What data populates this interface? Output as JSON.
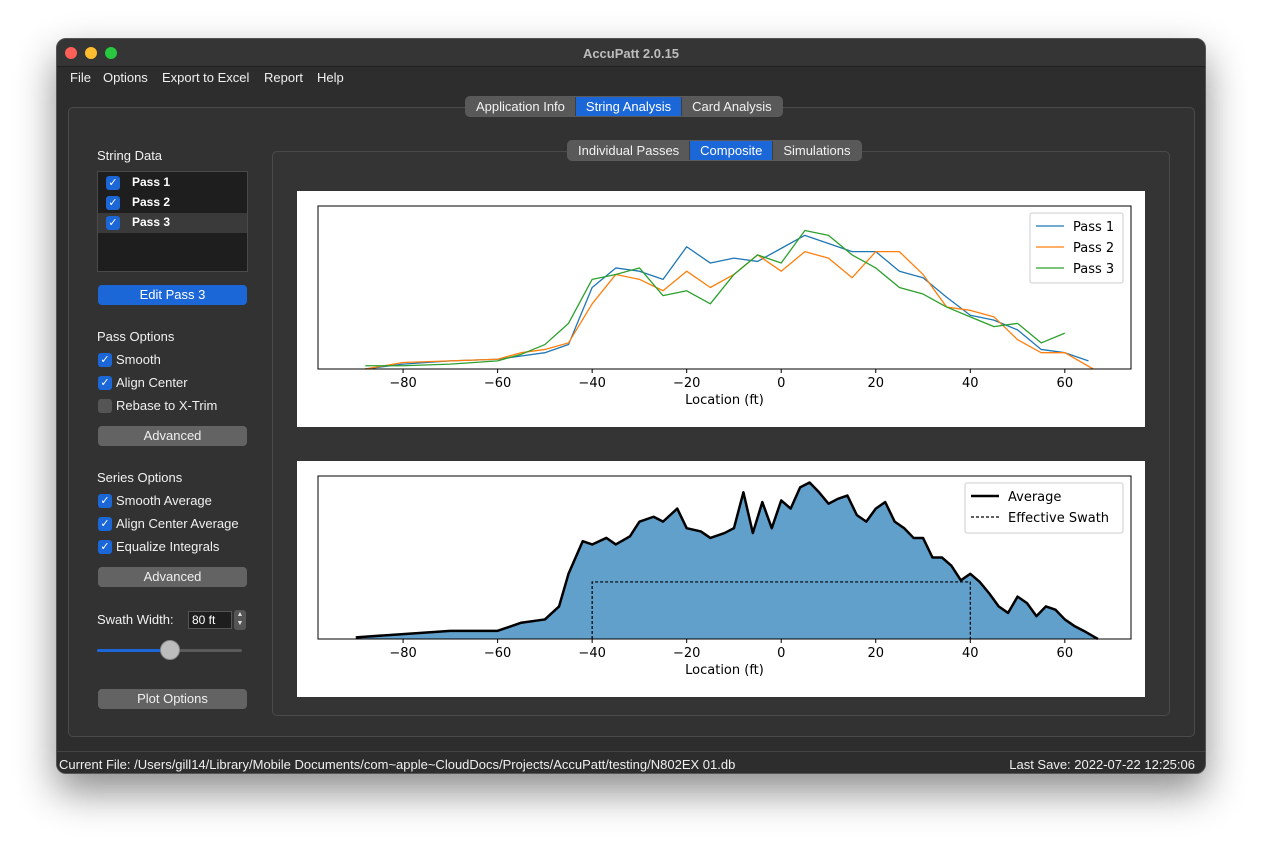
{
  "window": {
    "title": "AccuPatt 2.0.15"
  },
  "menu": [
    "File",
    "Options",
    "Export to Excel",
    "Report",
    "Help"
  ],
  "main_tabs": [
    {
      "label": "Application Info",
      "active": false
    },
    {
      "label": "String Analysis",
      "active": true
    },
    {
      "label": "Card Analysis",
      "active": false
    }
  ],
  "sub_tabs": [
    {
      "label": "Individual Passes",
      "active": false
    },
    {
      "label": "Composite",
      "active": true
    },
    {
      "label": "Simulations",
      "active": false
    }
  ],
  "sidebar": {
    "string_data_label": "String Data",
    "passes": [
      {
        "label": "Pass 1",
        "checked": true
      },
      {
        "label": "Pass 2",
        "checked": true
      },
      {
        "label": "Pass 3",
        "checked": true
      }
    ],
    "edit_button": "Edit Pass 3",
    "pass_options_label": "Pass Options",
    "pass_options": [
      {
        "label": "Smooth",
        "checked": true
      },
      {
        "label": "Align Center",
        "checked": true
      },
      {
        "label": "Rebase to X-Trim",
        "checked": false
      }
    ],
    "advanced_label": "Advanced",
    "series_options_label": "Series Options",
    "series_options": [
      {
        "label": "Smooth Average",
        "checked": true
      },
      {
        "label": "Align Center Average",
        "checked": true
      },
      {
        "label": "Equalize Integrals",
        "checked": true
      }
    ],
    "swath_label": "Swath Width:",
    "swath_value": "80 ft",
    "swath_slider_fraction": 0.5,
    "plot_options_label": "Plot Options"
  },
  "colors": {
    "accent": "#1b67d8",
    "pass1": "#1f77b4",
    "pass2": "#ff7f0e",
    "pass3": "#2ca02c",
    "average_fill": "#62a0cc"
  },
  "chart_data": [
    {
      "type": "line",
      "xlabel": "Location (ft)",
      "xlim": [
        -98,
        74
      ],
      "ylim": [
        0,
        1
      ],
      "xticks": [
        -80,
        -60,
        -40,
        -20,
        0,
        20,
        40,
        60
      ],
      "legend": "top-right",
      "grid": false,
      "series": [
        {
          "name": "Pass 1",
          "x": [
            -88,
            -80,
            -70,
            -60,
            -55,
            -50,
            -45,
            -40,
            -35,
            -30,
            -25,
            -20,
            -15,
            -10,
            -5,
            0,
            5,
            10,
            15,
            20,
            25,
            30,
            35,
            40,
            45,
            50,
            55,
            60,
            65
          ],
          "y": [
            0.0,
            0.03,
            0.05,
            0.06,
            0.08,
            0.1,
            0.15,
            0.5,
            0.62,
            0.6,
            0.55,
            0.75,
            0.65,
            0.68,
            0.66,
            0.74,
            0.82,
            0.77,
            0.72,
            0.72,
            0.6,
            0.56,
            0.44,
            0.33,
            0.3,
            0.24,
            0.12,
            0.1,
            0.05
          ]
        },
        {
          "name": "Pass 2",
          "x": [
            -88,
            -80,
            -70,
            -60,
            -55,
            -50,
            -45,
            -40,
            -35,
            -30,
            -25,
            -20,
            -15,
            -10,
            -5,
            0,
            5,
            10,
            15,
            20,
            25,
            30,
            35,
            40,
            45,
            50,
            55,
            60,
            66
          ],
          "y": [
            0.0,
            0.04,
            0.05,
            0.06,
            0.1,
            0.12,
            0.16,
            0.4,
            0.58,
            0.55,
            0.48,
            0.6,
            0.5,
            0.58,
            0.7,
            0.6,
            0.72,
            0.68,
            0.56,
            0.72,
            0.72,
            0.58,
            0.38,
            0.36,
            0.32,
            0.18,
            0.1,
            0.1,
            0.0
          ]
        },
        {
          "name": "Pass 3",
          "x": [
            -88,
            -80,
            -70,
            -60,
            -55,
            -50,
            -45,
            -40,
            -35,
            -30,
            -25,
            -20,
            -15,
            -10,
            -5,
            0,
            5,
            10,
            15,
            20,
            25,
            30,
            35,
            40,
            45,
            50,
            55,
            60
          ],
          "y": [
            0.02,
            0.02,
            0.03,
            0.05,
            0.09,
            0.15,
            0.28,
            0.55,
            0.58,
            0.62,
            0.45,
            0.48,
            0.4,
            0.58,
            0.7,
            0.65,
            0.85,
            0.82,
            0.7,
            0.62,
            0.5,
            0.46,
            0.38,
            0.32,
            0.26,
            0.28,
            0.16,
            0.22
          ]
        }
      ]
    },
    {
      "type": "area",
      "xlabel": "Location (ft)",
      "xlim": [
        -98,
        74
      ],
      "ylim": [
        0,
        1
      ],
      "xticks": [
        -80,
        -60,
        -40,
        -20,
        0,
        20,
        40,
        60
      ],
      "legend": "top-right",
      "grid": false,
      "series": [
        {
          "name": "Average",
          "x": [
            -90,
            -80,
            -70,
            -60,
            -55,
            -50,
            -47,
            -45,
            -42,
            -40,
            -37,
            -35,
            -32,
            -30,
            -27,
            -25,
            -22,
            -20,
            -17,
            -15,
            -12,
            -10,
            -8,
            -6,
            -4,
            -2,
            0,
            2,
            4,
            6,
            8,
            10,
            12,
            14,
            16,
            18,
            20,
            22,
            24,
            26,
            28,
            30,
            32,
            34,
            36,
            38,
            40,
            42,
            44,
            46,
            48,
            50,
            52,
            54,
            56,
            58,
            60,
            62,
            64,
            67
          ],
          "y": [
            0.01,
            0.03,
            0.05,
            0.05,
            0.1,
            0.12,
            0.2,
            0.4,
            0.6,
            0.58,
            0.62,
            0.58,
            0.63,
            0.72,
            0.75,
            0.72,
            0.8,
            0.68,
            0.66,
            0.62,
            0.65,
            0.68,
            0.9,
            0.65,
            0.84,
            0.68,
            0.85,
            0.8,
            0.93,
            0.96,
            0.9,
            0.83,
            0.86,
            0.88,
            0.76,
            0.72,
            0.8,
            0.84,
            0.72,
            0.68,
            0.62,
            0.62,
            0.5,
            0.5,
            0.45,
            0.36,
            0.4,
            0.35,
            0.28,
            0.2,
            0.16,
            0.26,
            0.22,
            0.14,
            0.2,
            0.18,
            0.12,
            0.08,
            0.05,
            0.0
          ]
        },
        {
          "name": "Effective Swath",
          "x": [
            -40,
            -40,
            40,
            40
          ],
          "y": [
            0,
            0.35,
            0.35,
            0
          ]
        }
      ]
    }
  ],
  "status": {
    "left": "Current File: /Users/gill14/Library/Mobile Documents/com~apple~CloudDocs/Projects/AccuPatt/testing/N802EX 01.db",
    "right": "Last Save: 2022-07-22 12:25:06"
  }
}
